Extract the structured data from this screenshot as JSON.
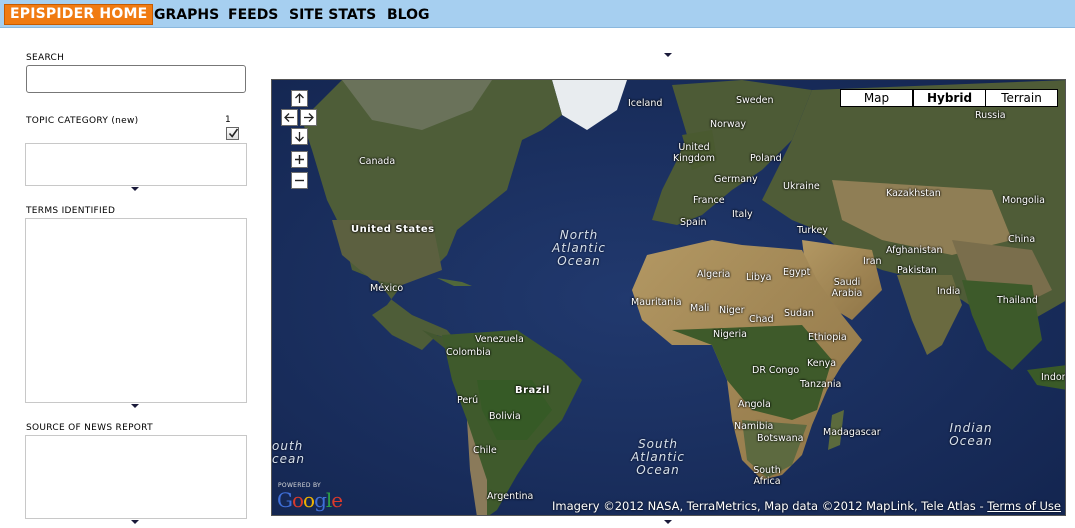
{
  "nav": {
    "home": "EPISPIDER HOME",
    "links": [
      "GRAPHS",
      "FEEDS",
      "SITE STATS",
      "BLOG"
    ]
  },
  "sidebar": {
    "search_label": "SEARCH",
    "search_value": "",
    "topic_label": "TOPIC CATEGORY (new)",
    "topic_count": "1",
    "topic_checked": true,
    "terms_label": "TERMS IDENTIFIED",
    "source_label": "SOURCE OF NEWS REPORT"
  },
  "map": {
    "types": [
      "Map",
      "Hybrid",
      "Terrain"
    ],
    "active_type": "Hybrid",
    "labels": {
      "iceland": "Iceland",
      "sweden": "Sweden",
      "russia": "Russia",
      "norway": "Norway",
      "united_kingdom": "United Kingdom",
      "poland": "Poland",
      "canada": "Canada",
      "germany": "Germany",
      "ukraine": "Ukraine",
      "france": "France",
      "kazakhstan": "Kazakhstan",
      "mongolia": "Mongolia",
      "spain": "Spain",
      "italy": "Italy",
      "turkey": "Turkey",
      "china": "China",
      "united_states": "United States",
      "afghanistan": "Afghanistan",
      "iran": "Iran",
      "pakistan": "Pakistan",
      "algeria": "Algeria",
      "libya": "Libya",
      "egypt": "Egypt",
      "saudi_arabia": "Saudi Arabia",
      "india": "India",
      "mexico": "México",
      "thailand": "Thailand",
      "mauritania": "Mauritania",
      "mali": "Mali",
      "niger": "Niger",
      "chad": "Chad",
      "sudan": "Sudan",
      "ethiopia": "Ethiopia",
      "nigeria": "Nigeria",
      "venezuela": "Venezuela",
      "colombia": "Colombia",
      "kenya": "Kenya",
      "dr_congo": "DR Congo",
      "tanzania": "Tanzania",
      "indonesia_partial": "Indon",
      "brazil": "Brazil",
      "peru": "Perú",
      "bolivia": "Bolivia",
      "angola": "Angola",
      "namibia": "Namibia",
      "botswana": "Botswana",
      "madagascar": "Madagascar",
      "chile": "Chile",
      "south_africa": "South Africa",
      "argentina": "Argentina"
    },
    "oceans": {
      "north_atlantic": "North Atlantic Ocean",
      "south_atlantic": "South Atlantic Ocean",
      "indian": "Indian Ocean",
      "south_pacific_partial": "outh cean"
    },
    "google": {
      "powered": "POWERED BY",
      "word": "Google"
    },
    "attribution": "Imagery ©2012 NASA, TerraMetrics, Map data ©2012 MapLink, Tele Atlas - ",
    "terms": "Terms of Use"
  },
  "colors": {
    "nav_bg": "#a6cff0",
    "home_bg": "#f07b12",
    "ocean": "#1b2f5e",
    "land": "#4a5b34",
    "desert": "#a38a5c"
  }
}
